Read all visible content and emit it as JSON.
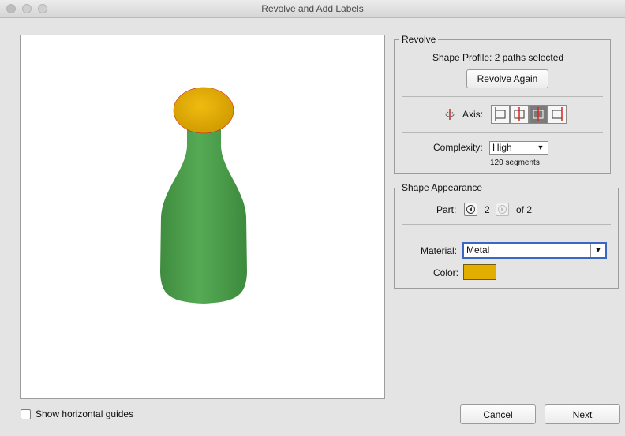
{
  "window": {
    "title": "Revolve and Add Labels"
  },
  "revolve": {
    "legend": "Revolve",
    "shape_profile": "Shape Profile: 2 paths selected",
    "revolve_again": "Revolve Again",
    "axis_label": "Axis:",
    "complexity_label": "Complexity:",
    "complexity_value": "High",
    "segments": "120 segments"
  },
  "appearance": {
    "legend": "Shape Appearance",
    "part_label": "Part:",
    "part_value": "2",
    "part_of": "of 2",
    "material_label": "Material:",
    "material_value": "Metal",
    "color_label": "Color:",
    "color_hex": "#e2ae00"
  },
  "footer": {
    "guides_label": "Show horizontal guides",
    "cancel": "Cancel",
    "next": "Next"
  },
  "icons": {
    "axis": "rotate-axis-icon",
    "prev": "previous-arrow-icon",
    "next": "next-arrow-icon"
  },
  "colors": {
    "bottle": "#4fa14f",
    "cap": "#e2ae00",
    "axis_line": "#d9241e"
  }
}
